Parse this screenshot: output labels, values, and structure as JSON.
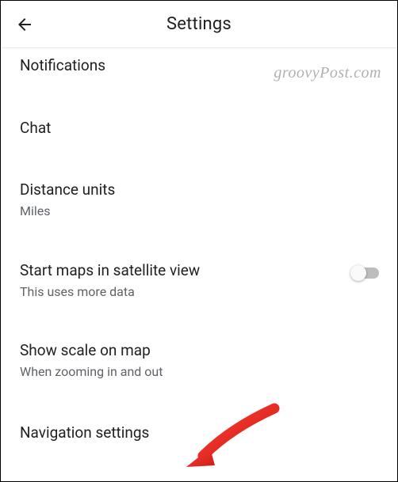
{
  "header": {
    "title": "Settings"
  },
  "items": {
    "notifications": {
      "title": "Notifications"
    },
    "chat": {
      "title": "Chat"
    },
    "distance": {
      "title": "Distance units",
      "sub": "Miles"
    },
    "satellite": {
      "title": "Start maps in satellite view",
      "sub": "This uses more data"
    },
    "scale": {
      "title": "Show scale on map",
      "sub": "When zooming in and out"
    },
    "navigation": {
      "title": "Navigation settings"
    }
  },
  "watermark": "groovyPost.com"
}
